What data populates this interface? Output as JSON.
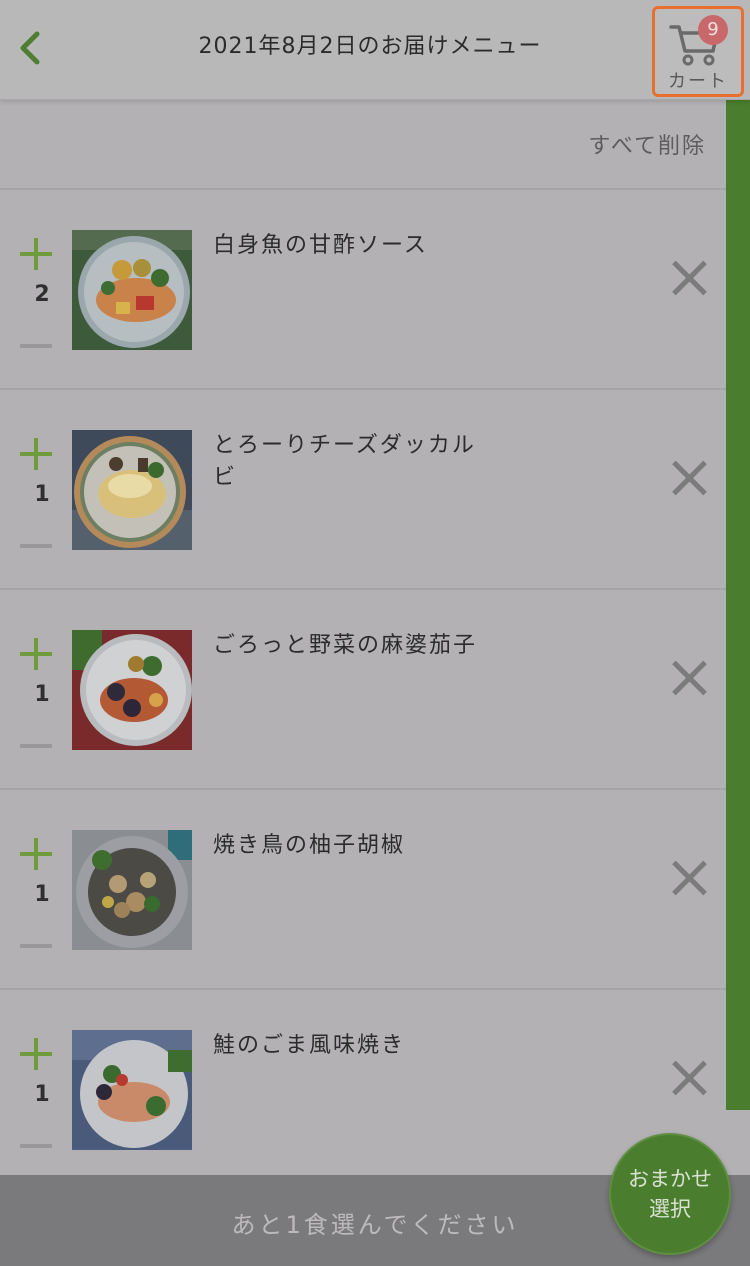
{
  "header": {
    "title": "2021年8月2日のお届けメニュー",
    "cart_label": "カート",
    "cart_count": "9"
  },
  "actions": {
    "delete_all": "すべて削除"
  },
  "items": [
    {
      "name": "白身魚の甘酢ソース",
      "qty": "2",
      "image": "white-fish-sweet-sour"
    },
    {
      "name": "とろーりチーズダッカルビ",
      "qty": "1",
      "image": "cheese-dakgalbi"
    },
    {
      "name": "ごろっと野菜の麻婆茄子",
      "qty": "1",
      "image": "mapo-eggplant"
    },
    {
      "name": "焼き鳥の柚子胡椒",
      "qty": "1",
      "image": "yakitori-yuzu"
    },
    {
      "name": "鮭のごま風味焼き",
      "qty": "1",
      "image": "salmon-sesame"
    }
  ],
  "footer": {
    "message": "あと1食選んでください",
    "omakase_line1": "おまかせ",
    "omakase_line2": "選択"
  },
  "colors": {
    "accent_green": "#4a7d2e",
    "plus_green": "#6f9b3c",
    "cart_highlight": "#e8702f",
    "badge": "#c9686a"
  }
}
